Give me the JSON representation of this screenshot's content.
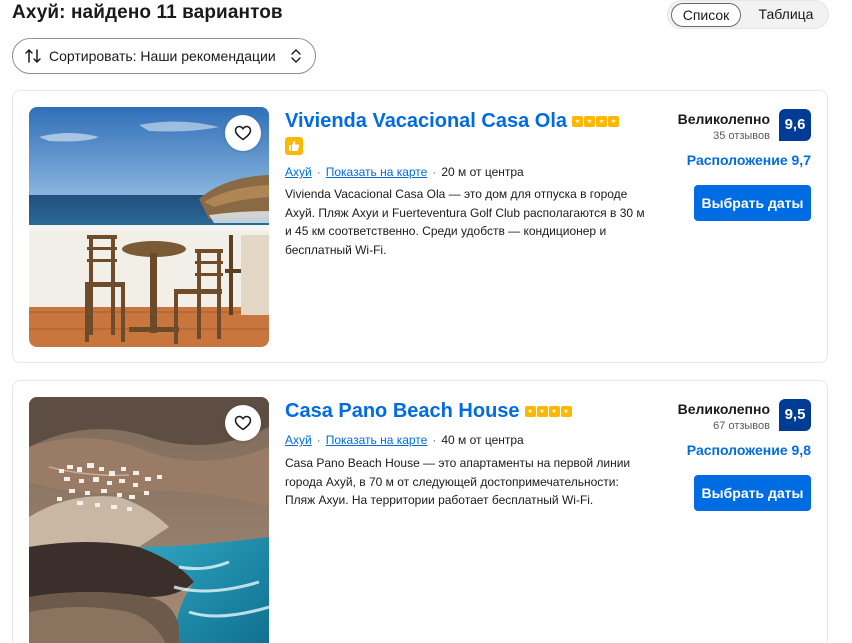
{
  "header": {
    "title": "Ахуй: найдено 11 вариантов",
    "view_list": "Список",
    "view_table": "Таблица",
    "sort_label": "Сортировать: Наши рекомендации"
  },
  "listings": [
    {
      "name": "Vivienda Vacacional Casa Ola",
      "stars": 4,
      "location_link": "Ахуй",
      "map_link": "Показать на карте",
      "distance": "20 м от центра",
      "description": "Vivienda Vacacional Casa Ola — это дом для отпуска в городе Ахуй. Пляж Ахуи и Fuerteventura Golf Club располагаются в 30 м и 45 км соответственно. Среди удобств — кондиционер и бесплатный Wi-Fi.",
      "rating_word": "Великолепно",
      "reviews": "35 отзывов",
      "score": "9,6",
      "location_score": "Расположение 9,7",
      "button": "Выбрать даты",
      "photo": "balcony-sea-view",
      "badge_icon": "thumbs-up-icon"
    },
    {
      "name": "Casa Pano Beach House",
      "stars": 4,
      "location_link": "Ахуй",
      "map_link": "Показать на карте",
      "distance": "40 м от центра",
      "description": "Casa Pano Beach House — это апартаменты на первой линии города Ахуй, в 70 м от следующей достопримечательности: Пляж Ахуи. На территории работает бесплатный Wi-Fi.",
      "rating_word": "Великолепно",
      "reviews": "67 отзывов",
      "score": "9,5",
      "location_score": "Расположение 9,8",
      "button": "Выбрать даты",
      "photo": "aerial-village-coast"
    }
  ],
  "colors": {
    "link_blue": "#006ce4",
    "score_navy": "#003b95",
    "star_yellow": "#ffb700",
    "button_blue": "#006ce4"
  }
}
